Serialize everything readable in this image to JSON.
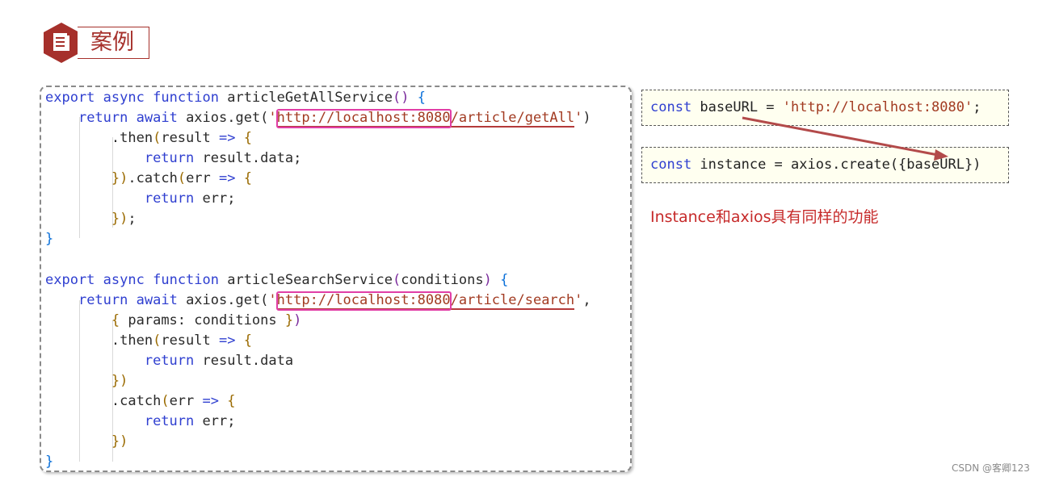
{
  "header": {
    "title": "案例",
    "icon": "document-icon"
  },
  "code": {
    "f1_sig": {
      "kw1": "export",
      "kw2": "async",
      "kw3": "function",
      "name": "articleGetAllService",
      "params": "()",
      "open": "{"
    },
    "f1_ret": {
      "kw1": "return",
      "kw2": "await",
      "call": "axios.get(",
      "q1": "'",
      "host": "http://localhost:8080",
      "path": "/article/getAll",
      "q2": "'",
      "close": ")"
    },
    "f1_then": {
      "text": ".then",
      "p": "(",
      "arg": "result",
      "arrow": "=>",
      "open": "{"
    },
    "f1_thenret": {
      "kw": "return",
      "rest": " result.data;"
    },
    "f1_catch": {
      "close": "}",
      "p": ")",
      "text": ".catch",
      "p2": "(",
      "arg": "err",
      "arrow": "=>",
      "open": "{"
    },
    "f1_catchret": {
      "kw": "return",
      "rest": " err;"
    },
    "f1_end": {
      "close": "}",
      "p": ")",
      "semi": ";"
    },
    "f1_close": "}",
    "f2_sig": {
      "kw1": "export",
      "kw2": "async",
      "kw3": "function",
      "name": "articleSearchService",
      "p": "(",
      "param": "conditions",
      "p2": ")",
      "open": "{"
    },
    "f2_ret": {
      "kw1": "return",
      "kw2": "await",
      "call": "axios.get(",
      "q1": "'",
      "host": "http://localhost:8080",
      "path": "/article/search",
      "q2": "'",
      "comma": ","
    },
    "f2_params": {
      "open": "{",
      "text": " params: conditions ",
      "close": "}",
      "p": ")"
    },
    "f2_then": {
      "text": ".then",
      "p": "(",
      "arg": "result",
      "arrow": "=>",
      "open": "{"
    },
    "f2_thenret": {
      "kw": "return",
      "rest": " result.data"
    },
    "f2_thenclose": {
      "close": "}",
      "p": ")"
    },
    "f2_catch": {
      "text": ".catch",
      "p": "(",
      "arg": "err",
      "arrow": "=>",
      "open": "{"
    },
    "f2_catchret": {
      "kw": "return",
      "rest": " err;"
    },
    "f2_catchclose": {
      "close": "}",
      "p": ")"
    },
    "f2_close": "}"
  },
  "snippets": {
    "base": {
      "kw": "const",
      "rest": " baseURL = ",
      "str": "'http://localhost:8080'",
      "end": ";"
    },
    "instance": {
      "kw": "const",
      "rest": " instance = axios.create({baseURL})"
    }
  },
  "note": "Instance和axios具有同样的功能",
  "watermark": "CSDN @客卿123",
  "colors": {
    "brand_red": "#a6302b",
    "highlight_pink": "#e13ea6",
    "note_red": "#c62a2a",
    "keyword_blue": "#2f3fd0"
  }
}
